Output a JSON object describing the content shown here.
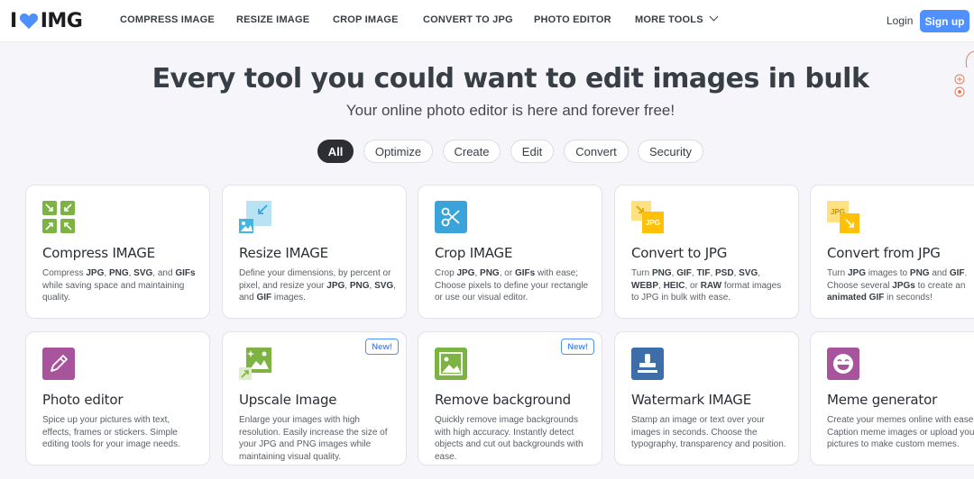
{
  "brand": {
    "logo_left": "I",
    "logo_right": "IMG"
  },
  "nav": {
    "items": [
      "COMPRESS IMAGE",
      "RESIZE IMAGE",
      "CROP IMAGE",
      "CONVERT TO JPG",
      "PHOTO EDITOR",
      "MORE TOOLS"
    ],
    "login": "Login",
    "signup": "Sign up"
  },
  "hero": {
    "title": "Every tool you could want to edit images in bulk",
    "subtitle": "Your online photo editor is here and forever free!"
  },
  "filters": [
    "All",
    "Optimize",
    "Create",
    "Edit",
    "Convert",
    "Security"
  ],
  "active_filter": "All",
  "badge_new": "New!",
  "tools": [
    {
      "title": "Compress IMAGE",
      "icon": "compress-icon",
      "color": "#7cb342",
      "desc": [
        "Compress ",
        "JPG",
        ", ",
        "PNG",
        ", ",
        "SVG",
        ", and ",
        "GIFs",
        " while saving space and maintaining quality."
      ]
    },
    {
      "title": "Resize IMAGE",
      "icon": "resize-icon",
      "color": "#45b5e0",
      "desc": [
        "Define your dimensions, by percent or pixel, and resize your ",
        "JPG",
        ", ",
        "PNG",
        ", ",
        "SVG",
        ", and ",
        "GIF",
        " images."
      ]
    },
    {
      "title": "Crop IMAGE",
      "icon": "scissors-icon",
      "color": "#3aa3d9",
      "desc": [
        "Crop ",
        "JPG",
        ", ",
        "PNG",
        ", or ",
        "GIFs",
        " with ease; Choose pixels to define your rectangle or use our visual editor."
      ]
    },
    {
      "title": "Convert to JPG",
      "icon": "convert-to-jpg-icon",
      "color": "#ffc107",
      "desc": [
        "Turn ",
        "PNG",
        ", ",
        "GIF",
        ", ",
        "TIF",
        ", ",
        "PSD",
        ", ",
        "SVG",
        ", ",
        "WEBP",
        ", ",
        "HEIC",
        ", or ",
        "RAW",
        " format images to JPG in bulk with ease."
      ]
    },
    {
      "title": "Convert from JPG",
      "icon": "convert-from-jpg-icon",
      "color": "#ffc107",
      "desc": [
        "Turn ",
        "JPG",
        " images to ",
        "PNG",
        " and ",
        "GIF",
        ". Choose several ",
        "JPGs",
        " to create an ",
        "animated GIF",
        " in seconds!"
      ]
    },
    {
      "title": "Photo editor",
      "icon": "pencil-icon",
      "color": "#a8549c",
      "desc": [
        "Spice up your pictures with text, effects, frames or stickers. Simple editing tools for your image needs."
      ]
    },
    {
      "title": "Upscale Image",
      "icon": "upscale-icon",
      "color": "#7cb342",
      "new": true,
      "desc": [
        "Enlarge your images with high resolution. Easily increase the size of your JPG and PNG images while maintaining visual quality."
      ]
    },
    {
      "title": "Remove background",
      "icon": "remove-background-icon",
      "color": "#7cb342",
      "new": true,
      "desc": [
        "Quickly remove image backgrounds with high accuracy. Instantly detect objects and cut out backgrounds with ease."
      ]
    },
    {
      "title": "Watermark IMAGE",
      "icon": "stamp-icon",
      "color": "#3d6ea8",
      "desc": [
        "Stamp an image or text over your images in seconds. Choose the typography, transparency and position."
      ]
    },
    {
      "title": "Meme generator",
      "icon": "smiley-icon",
      "color": "#a8549c",
      "desc": [
        "Create your memes online with ease. Caption meme images or upload your pictures to make custom memes."
      ]
    }
  ]
}
